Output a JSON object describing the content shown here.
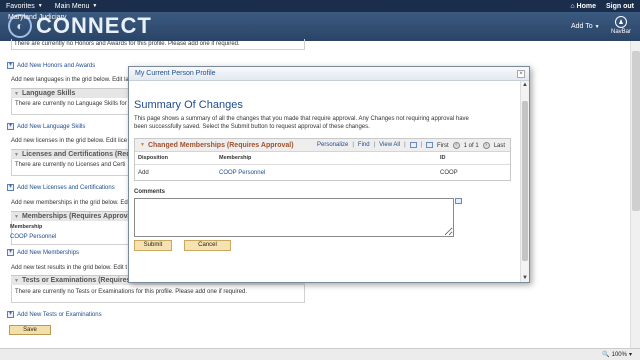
{
  "topbar": {
    "favorites": "Favorites",
    "main_menu": "Main Menu",
    "home": "Home",
    "sign_out": "Sign out"
  },
  "banner": {
    "logo_text": "CONNECT",
    "logo_sub": "Maryland Judiciary",
    "add_to": "Add To",
    "navbar": "NavBar"
  },
  "background": {
    "honors_msg": "There are currently no Honors and Awards for this profile.  Please add one if required.",
    "add_honors": "Add New Honors and Awards",
    "lang_grid_msg": "Add new languages in the grid below. Edit lan",
    "lang_section": "Language Skills",
    "lang_msg": "There are currently no Language Skills for",
    "add_language": "Add New Language Skills",
    "lic_grid_msg": "Add new licenses in the grid below. Edit lice",
    "lic_section": "Licenses and Certifications (Requ",
    "lic_msg": "There are currently no Licenses and Certi",
    "add_license": "Add New Licenses and Certifications",
    "mem_grid_msg": "Add new memberships in the grid below. Edi",
    "mem_section": "Memberships (Requires Approva",
    "mem_col": "Membership",
    "mem_value": "COOP Personnel",
    "add_membership": "Add New Memberships",
    "test_grid_msg": "Add new test results in the grid below. Edit t",
    "test_section": "Tests or Examinations (Requires",
    "test_msg": "There are currently no Tests or Examinations for this profile.  Please add one if required.",
    "add_test": "Add New Tests or Examinations",
    "save": "Save"
  },
  "statusbar": {
    "zoom": "100%"
  },
  "modal": {
    "title": "My Current Person Profile",
    "close": "×",
    "heading": "Summary Of Changes",
    "description": "This page shows a summary of all the changes that you made that require approval. Any Changes not requiring approval have been successfully saved. Select the Submit button to request approval of these changes.",
    "grid": {
      "title": "Changed Memberships (Requires Approval)",
      "personalize": "Personalize",
      "find": "Find",
      "view_all": "View All",
      "first": "First",
      "range": "1 of 1",
      "last": "Last",
      "columns": [
        "Disposition",
        "Membership",
        "ID"
      ],
      "rows": [
        {
          "disposition": "Add",
          "membership": "COOP Personnel",
          "id": "COOP"
        }
      ]
    },
    "comments_label": "Comments",
    "comments_value": "",
    "submit": "Submit",
    "cancel": "Cancel"
  }
}
